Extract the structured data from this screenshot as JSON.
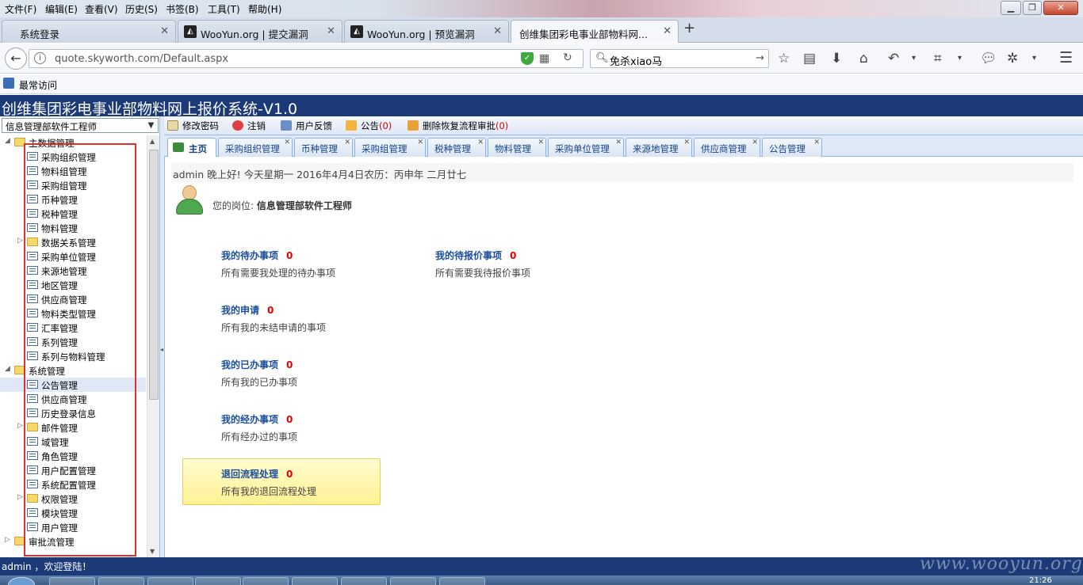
{
  "browser": {
    "menu": [
      "文件(F)",
      "编辑(E)",
      "查看(V)",
      "历史(S)",
      "书签(B)",
      "工具(T)",
      "帮助(H)"
    ],
    "tabs": [
      {
        "label": "系统登录",
        "has_icon": false
      },
      {
        "label": "WooYun.org | 提交漏洞",
        "has_icon": true
      },
      {
        "label": "WooYun.org | 预览漏洞",
        "has_icon": true
      },
      {
        "label": "创维集团彩电事业部物料网...",
        "has_icon": false,
        "active": true
      }
    ],
    "url": "quote.skyworth.com/Default.aspx",
    "search_value": "免杀xiao马",
    "bookmark_label": "最常访问"
  },
  "app": {
    "title": "创维集团彩电事业部物料网上报价系统-V1.0",
    "role_select_value": "信息管理部软件工程师",
    "toolbar": {
      "change_password": "修改密码",
      "logout": "注销",
      "feedback": "用户反馈",
      "notice": "公告",
      "notice_count": "(0)",
      "delete_restore": "删除恢复流程审批",
      "delete_restore_count": "(0)"
    },
    "tabs": [
      "主页",
      "采购组织管理",
      "币种管理",
      "采购组管理",
      "税种管理",
      "物料管理",
      "采购单位管理",
      "来源地管理",
      "供应商管理",
      "公告管理"
    ],
    "tree": [
      {
        "label": "主数据管理",
        "type": "folder",
        "level": 0,
        "expanded": true
      },
      {
        "label": "采购组织管理",
        "type": "page",
        "level": 1
      },
      {
        "label": "物料组管理",
        "type": "page",
        "level": 1
      },
      {
        "label": "采购组管理",
        "type": "page",
        "level": 1
      },
      {
        "label": "币种管理",
        "type": "page",
        "level": 1
      },
      {
        "label": "税种管理",
        "type": "page",
        "level": 1
      },
      {
        "label": "物料管理",
        "type": "page",
        "level": 1
      },
      {
        "label": "数据关系管理",
        "type": "folder",
        "level": 1,
        "expanded": false
      },
      {
        "label": "采购单位管理",
        "type": "page",
        "level": 1
      },
      {
        "label": "来源地管理",
        "type": "page",
        "level": 1
      },
      {
        "label": "地区管理",
        "type": "page",
        "level": 1
      },
      {
        "label": "供应商管理",
        "type": "page",
        "level": 1
      },
      {
        "label": "物料类型管理",
        "type": "page",
        "level": 1
      },
      {
        "label": "汇率管理",
        "type": "page",
        "level": 1
      },
      {
        "label": "系列管理",
        "type": "page",
        "level": 1
      },
      {
        "label": "系列与物料管理",
        "type": "page",
        "level": 1
      },
      {
        "label": "系统管理",
        "type": "folder",
        "level": 0,
        "expanded": true
      },
      {
        "label": "公告管理",
        "type": "page",
        "level": 1,
        "selected": true
      },
      {
        "label": "供应商管理",
        "type": "page",
        "level": 1
      },
      {
        "label": "历史登录信息",
        "type": "page",
        "level": 1
      },
      {
        "label": "邮件管理",
        "type": "folder",
        "level": 1,
        "expanded": false
      },
      {
        "label": "域管理",
        "type": "page",
        "level": 1
      },
      {
        "label": "角色管理",
        "type": "page",
        "level": 1
      },
      {
        "label": "用户配置管理",
        "type": "page",
        "level": 1
      },
      {
        "label": "系统配置管理",
        "type": "page",
        "level": 1
      },
      {
        "label": "权限管理",
        "type": "folder",
        "level": 1,
        "expanded": false
      },
      {
        "label": "模块管理",
        "type": "page",
        "level": 1
      },
      {
        "label": "用户管理",
        "type": "page",
        "level": 1
      },
      {
        "label": "审批流管理",
        "type": "folder",
        "level": 0,
        "expanded": false
      }
    ],
    "greeting": "admin 晚上好! 今天星期一 2016年4月4日农历：丙申年 二月廿七",
    "position_label": "您的岗位:",
    "position_value": "信息管理部软件工程师",
    "tasks": {
      "todo": {
        "title": "我的待办事项",
        "count": "0",
        "desc": "所有需要我处理的待办事项"
      },
      "quote": {
        "title": "我的待报价事项",
        "count": "0",
        "desc": "所有需要我待报价事项"
      },
      "apply": {
        "title": "我的申请",
        "count": "0",
        "desc": "所有我的未结申请的事项"
      },
      "done": {
        "title": "我的已办事项",
        "count": "0",
        "desc": "所有我的已办事项"
      },
      "handled": {
        "title": "我的经办事项",
        "count": "0",
        "desc": "所有经办过的事项"
      },
      "returned": {
        "title": "退回流程处理",
        "count": "0",
        "desc": "所有我的退回流程处理"
      }
    },
    "status": "admin ，欢迎登陆！",
    "watermark": "www.wooyun.org"
  },
  "taskbar": {
    "clock": "21:26"
  },
  "colors": {
    "header_bg": "#1d3a78",
    "highlight_border": "#e0322c",
    "task_title": "#1a4e9c",
    "count_red": "#e00000"
  }
}
